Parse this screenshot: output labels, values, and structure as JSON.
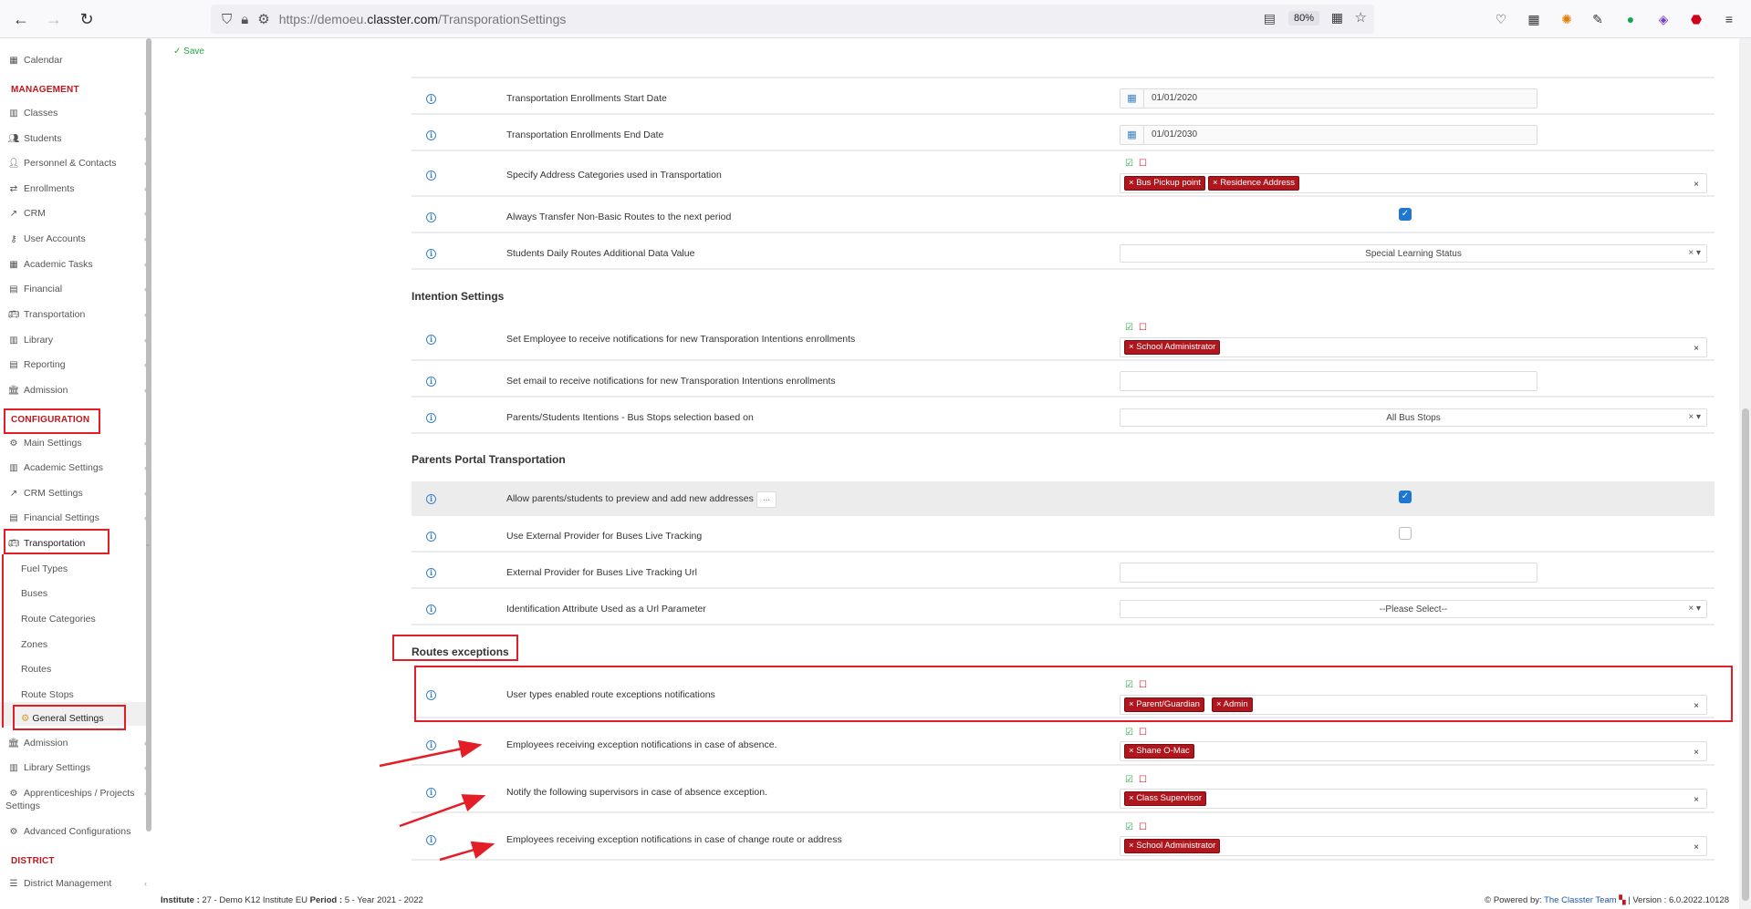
{
  "browser": {
    "url_gray_prefix": "https://demoeu.",
    "url_domain": "classter.com",
    "url_path": "/TransporationSettings",
    "zoom": "80%"
  },
  "sidebar": {
    "top_items": [
      {
        "label": "Calendar",
        "icon": "calendar-icon"
      }
    ],
    "management_header": "MANAGEMENT",
    "management_items": [
      {
        "label": "Classes",
        "icon": "classes-icon"
      },
      {
        "label": "Students",
        "icon": "students-icon"
      },
      {
        "label": "Personnel & Contacts",
        "icon": "personnel-icon"
      },
      {
        "label": "Enrollments",
        "icon": "enrollments-icon"
      },
      {
        "label": "CRM",
        "icon": "crm-icon"
      },
      {
        "label": "User Accounts",
        "icon": "user-accounts-icon"
      },
      {
        "label": "Academic Tasks",
        "icon": "academic-tasks-icon"
      },
      {
        "label": "Financial",
        "icon": "financial-icon"
      },
      {
        "label": "Transportation",
        "icon": "bus-icon"
      },
      {
        "label": "Library",
        "icon": "library-icon"
      },
      {
        "label": "Reporting",
        "icon": "reporting-icon"
      },
      {
        "label": "Admission",
        "icon": "admission-icon"
      }
    ],
    "configuration_header": "CONFIGURATION",
    "configuration_items": [
      {
        "label": "Main Settings"
      },
      {
        "label": "Academic Settings"
      },
      {
        "label": "CRM Settings"
      },
      {
        "label": "Financial Settings"
      },
      {
        "label": "Transportation"
      }
    ],
    "transportation_sub": [
      "Fuel Types",
      "Buses",
      "Route Categories",
      "Zones",
      "Routes",
      "Route Stops",
      "General Settings"
    ],
    "configuration_after": [
      {
        "label": "Admission"
      },
      {
        "label": "Library Settings"
      },
      {
        "label": "Apprenticeships / Projects"
      },
      {
        "label": "Settings"
      },
      {
        "label": "Advanced Configurations"
      }
    ],
    "district_header": "DISTRICT",
    "district_items": [
      {
        "label": "District Management"
      }
    ]
  },
  "toolbar": {
    "save_label": "Save"
  },
  "settings": {
    "enroll_start_label": "Transportation Enrollments Start Date",
    "enroll_start_value": "01/01/2020",
    "enroll_end_label": "Transportation Enrollments End Date",
    "enroll_end_value": "01/01/2030",
    "address_cat_label": "Specify Address Categories used in Transportation",
    "address_cat_tags": [
      "Bus Pickup point",
      "Residence Address"
    ],
    "always_transfer_label": "Always Transfer Non-Basic Routes to the next period",
    "always_transfer_checked": true,
    "daily_routes_label": "Students Daily Routes Additional Data Value",
    "daily_routes_value": "Special Learning Status"
  },
  "intention": {
    "title": "Intention Settings",
    "employee_label": "Set Employee to receive notifications for new Transporation Intentions enrollments",
    "employee_tags": [
      "School Administrator"
    ],
    "email_label": "Set email to receive notifications for new Transporation Intentions enrollments",
    "bus_stops_label": "Parents/Students Itentions - Bus Stops selection based on",
    "bus_stops_value": "All Bus Stops"
  },
  "portal": {
    "title": "Parents Portal Transportation",
    "allow_label": "Allow parents/students to preview and add new addresses",
    "allow_checked": true,
    "more_label": "...",
    "external_label": "Use External Provider for Buses Live Tracking",
    "external_checked": false,
    "external_url_label": "External Provider for Buses Live Tracking Url",
    "id_attr_label": "Identification Attribute Used as a Url Parameter",
    "id_attr_value": "--Please Select--"
  },
  "exceptions": {
    "title": "Routes exceptions",
    "user_types_label": "User types enabled route exceptions notifications",
    "user_types_tags": [
      "Parent/Guardian",
      "Admin"
    ],
    "absence_emp_label": "Employees receiving exception notifications in case of absence.",
    "absence_emp_tags": [
      "Shane O-Mac"
    ],
    "supervisors_label": "Notify the following supervisors in case of absence exception.",
    "supervisors_tags": [
      "Class Supervisor"
    ],
    "change_route_label": "Employees receiving exception notifications in case of change route or address",
    "change_route_tags": [
      "School Administrator"
    ]
  },
  "footer": {
    "institute_key": "Institute :",
    "institute_val": "27 - Demo K12 Institute EU",
    "period_key": "Period :",
    "period_val": "5 - Year 2021 - 2022",
    "powered": "Powered by:",
    "team": "The Classter Team",
    "version": "| Version : 6.0.2022.10128"
  },
  "colors": {
    "accent_red": "#b0161d",
    "annotation_red": "#e41e26",
    "link_blue": "#1e5aa8",
    "check_blue": "#1e78d2"
  }
}
